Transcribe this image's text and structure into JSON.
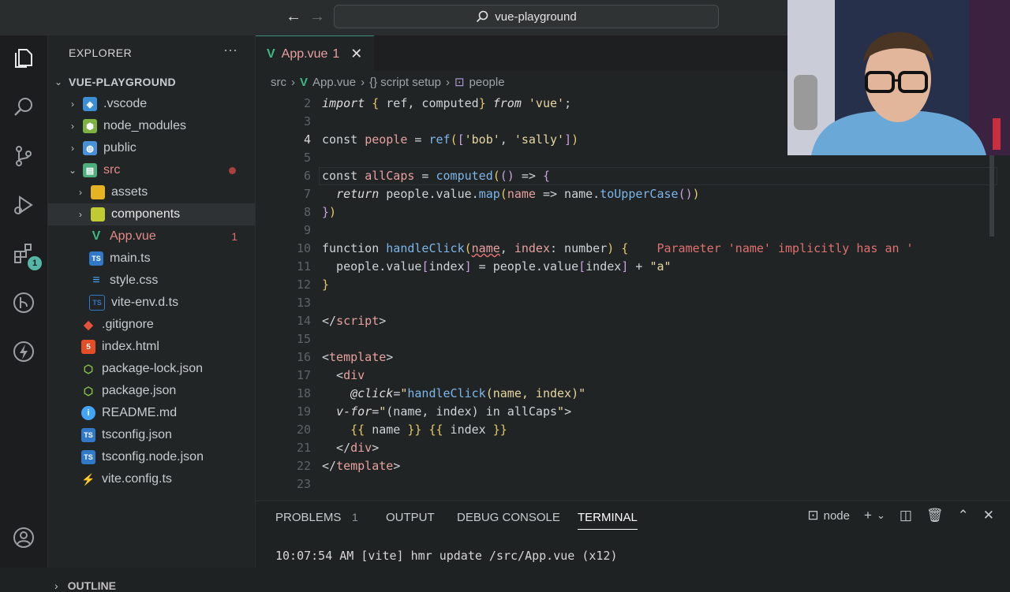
{
  "titlebar": {
    "search_text": "vue-playground"
  },
  "activity": {
    "extensions_badge": "1"
  },
  "explorer": {
    "title": "EXPLORER",
    "more": "···",
    "root": "VUE-PLAYGROUND",
    "items": [
      {
        "label": ".vscode",
        "icon": "vscode-folder-icon"
      },
      {
        "label": "node_modules",
        "icon": "node-folder-icon"
      },
      {
        "label": "public",
        "icon": "public-folder-icon"
      },
      {
        "label": "src",
        "icon": "src-folder-icon"
      },
      {
        "label": "assets",
        "icon": "assets-folder-icon"
      },
      {
        "label": "components",
        "icon": "components-folder-icon"
      },
      {
        "label": "App.vue",
        "icon": "vue-file-icon",
        "count": "1"
      },
      {
        "label": "main.ts",
        "icon": "ts-file-icon"
      },
      {
        "label": "style.css",
        "icon": "css-file-icon"
      },
      {
        "label": "vite-env.d.ts",
        "icon": "dts-file-icon"
      },
      {
        "label": ".gitignore",
        "icon": "git-file-icon"
      },
      {
        "label": "index.html",
        "icon": "html-file-icon"
      },
      {
        "label": "package-lock.json",
        "icon": "npm-file-icon"
      },
      {
        "label": "package.json",
        "icon": "npm-file-icon"
      },
      {
        "label": "README.md",
        "icon": "info-file-icon"
      },
      {
        "label": "tsconfig.json",
        "icon": "ts-config-icon"
      },
      {
        "label": "tsconfig.node.json",
        "icon": "ts-config-icon"
      },
      {
        "label": "vite.config.ts",
        "icon": "vite-file-icon"
      }
    ],
    "outline": "OUTLINE"
  },
  "editor": {
    "tab_label": "App.vue",
    "tab_count": "1",
    "breadcrumb": [
      "src",
      "App.vue",
      "{} script setup",
      "people"
    ],
    "line_numbers": [
      "2",
      "3",
      "4",
      "5",
      "6",
      "7",
      "8",
      "9",
      "10",
      "11",
      "12",
      "13",
      "14",
      "15",
      "16",
      "17",
      "18",
      "19",
      "20",
      "21",
      "22",
      "23"
    ],
    "current_line": "4",
    "error_inline": "Parameter 'name' implicitly has an '"
  },
  "panel": {
    "tabs": [
      "PROBLEMS",
      "OUTPUT",
      "DEBUG CONSOLE",
      "TERMINAL"
    ],
    "problems_count": "1",
    "terminal_label": "node",
    "terminal_line": "10:07:54 AM [vite] hmr update /src/App.vue (x12)"
  }
}
